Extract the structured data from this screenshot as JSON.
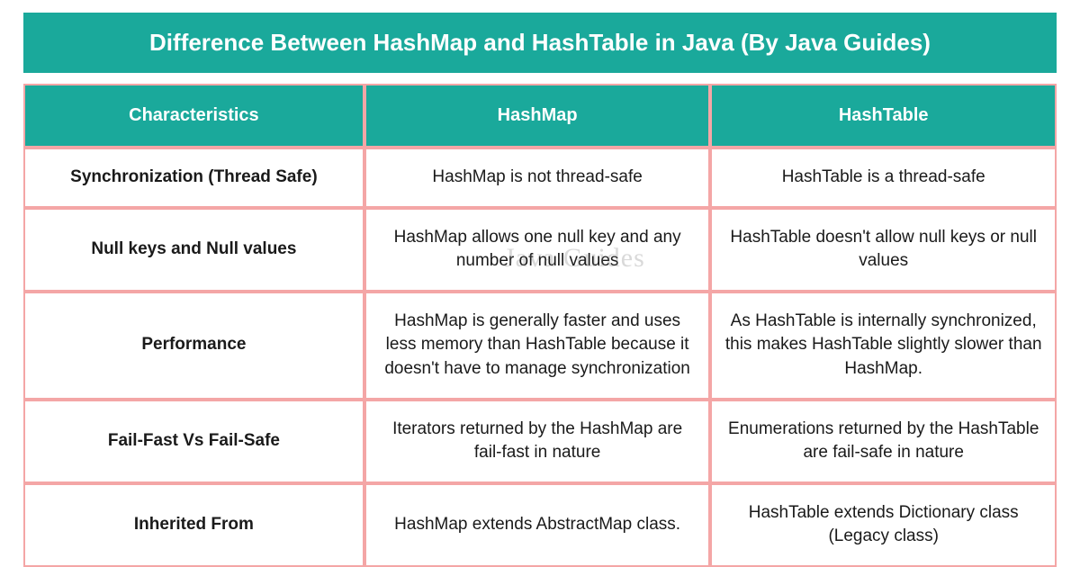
{
  "title": "Difference Between HashMap and HashTable in Java (By Java Guides)",
  "watermark": "Java Guides",
  "headers": {
    "col1": "Characteristics",
    "col2": "HashMap",
    "col3": "HashTable"
  },
  "rows": [
    {
      "characteristic": "Synchronization (Thread Safe)",
      "hashmap": "HashMap is not thread-safe",
      "hashtable": "HashTable is a thread-safe"
    },
    {
      "characteristic": "Null keys and Null values",
      "hashmap": "HashMap allows one null key and any number of null values",
      "hashtable": "HashTable doesn't allow null keys or null values"
    },
    {
      "characteristic": "Performance",
      "hashmap": "HashMap is generally faster and uses less memory than HashTable because it doesn't have to manage synchronization",
      "hashtable": "As HashTable is internally synchronized, this makes HashTable slightly slower than HashMap."
    },
    {
      "characteristic": "Fail-Fast Vs Fail-Safe",
      "hashmap": "Iterators returned by the HashMap are fail-fast in nature",
      "hashtable": "Enumerations returned by the HashTable are fail-safe in nature"
    },
    {
      "characteristic": "Inherited From",
      "hashmap": "HashMap extends AbstractMap class.",
      "hashtable": "HashTable extends Dictionary class (Legacy class)"
    }
  ]
}
